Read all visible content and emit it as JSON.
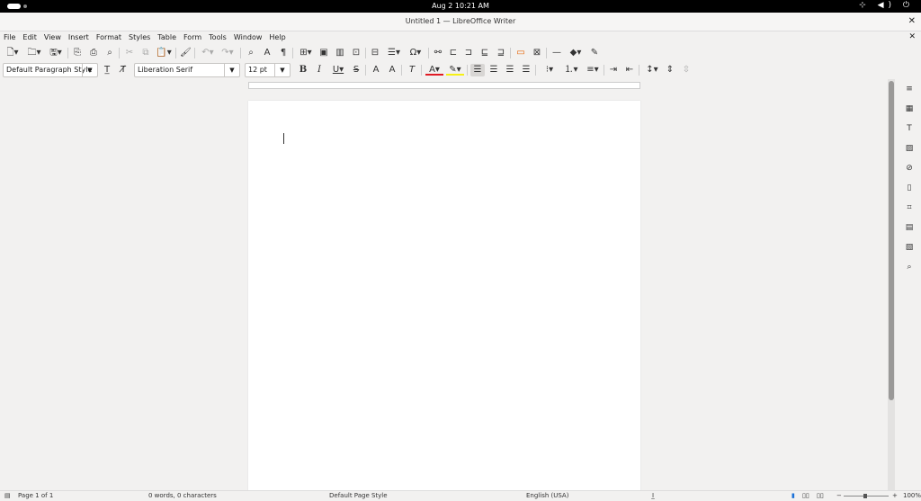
{
  "system": {
    "clock": "Aug 2  10:21 AM",
    "tray_icons": "⊹ ◀) ⏻"
  },
  "window": {
    "title": "Untitled 1 — LibreOffice Writer",
    "close": "✕"
  },
  "menubar": {
    "items": [
      "File",
      "Edit",
      "View",
      "Insert",
      "Format",
      "Styles",
      "Table",
      "Form",
      "Tools",
      "Window",
      "Help"
    ],
    "doc_close": "✕"
  },
  "toolbar2": {
    "paragraph_style": "Default Paragraph Style",
    "font_name": "Liberation Serif",
    "font_size": "12 pt"
  },
  "status": {
    "page": "Page 1 of 1",
    "words": "0 words, 0 characters",
    "page_style": "Default Page Style",
    "language": "English (USA)",
    "zoom": "100%"
  },
  "colors": {
    "font_color": "#e01b24",
    "highlight_color": "#f6f014"
  }
}
